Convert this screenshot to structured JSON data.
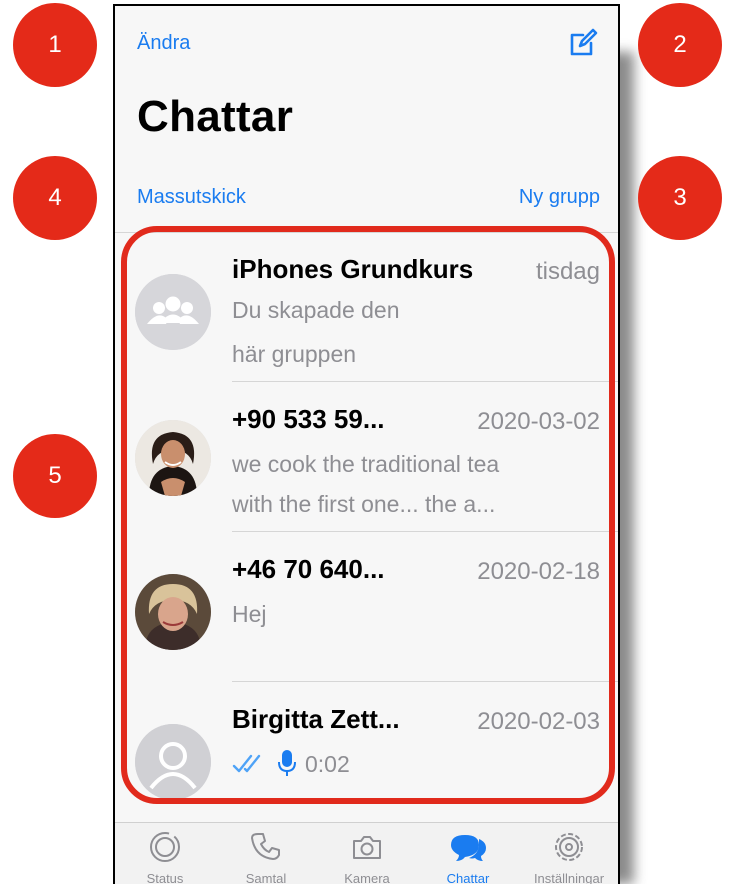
{
  "header": {
    "edit_label": "Ändra",
    "compose_icon": "compose-icon",
    "title": "Chattar",
    "broadcast_label": "Massutskick",
    "new_group_label": "Ny grupp"
  },
  "chats": [
    {
      "name": "iPhones Grundkurs",
      "date": "tisdag",
      "message_line1": "Du skapade den",
      "message_line2": "här gruppen",
      "avatar": "group-avatar-icon"
    },
    {
      "name": "+90 533 59...",
      "date": "2020-03-02",
      "message_line1": "we cook the traditional tea",
      "message_line2": "with the first one... the a...",
      "avatar": "photo-woman-dark-hair"
    },
    {
      "name": "+46 70 640...",
      "date": "2020-02-18",
      "message_line1": "Hej",
      "message_line2": "",
      "avatar": "photo-woman-blonde"
    },
    {
      "name": "Birgitta Zett...",
      "date": "2020-02-03",
      "voice_duration": "0:02",
      "avatar": "default-person-avatar-icon",
      "status_icon": "double-check-icon",
      "voice_icon": "microphone-icon"
    }
  ],
  "tabbar": [
    {
      "label": "Status",
      "icon": "status-icon"
    },
    {
      "label": "Samtal",
      "icon": "phone-icon"
    },
    {
      "label": "Kamera",
      "icon": "camera-icon"
    },
    {
      "label": "Chattar",
      "icon": "chats-icon",
      "active": true
    },
    {
      "label": "Inställningar",
      "icon": "settings-icon"
    }
  ],
  "annotations": {
    "badge_1": "1",
    "badge_2": "2",
    "badge_3": "3",
    "badge_4": "4",
    "badge_5": "5",
    "highlight_color": "#e12a1c"
  },
  "colors": {
    "accent": "#1a7cf0",
    "secondary_text": "#8e8e93",
    "badge": "#e42a19"
  }
}
